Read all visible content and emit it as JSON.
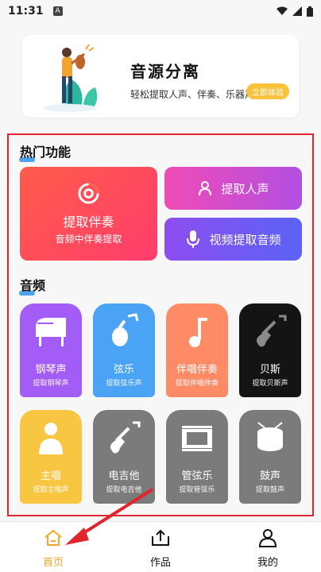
{
  "status_bar": {
    "time": "11:31",
    "a_icon_label": "A"
  },
  "banner": {
    "title": "音源分离",
    "subtitle": "轻松提取人声、伴奏、乐器声",
    "button": "立即体验"
  },
  "hot": {
    "title": "热门功能",
    "big_card": {
      "line1": "提取伴奏",
      "line2": "音频中伴奏提取"
    },
    "card_vocals": "提取人声",
    "card_video": "视频提取音频"
  },
  "audio": {
    "title": "音频",
    "tiles": [
      {
        "name": "钢琴声",
        "desc": "提取钢琴声",
        "color": "#a45cf7",
        "icon": "piano-icon"
      },
      {
        "name": "弦乐",
        "desc": "提取弦乐声",
        "color": "#4aa3f4",
        "icon": "violin-icon"
      },
      {
        "name": "伴唱伴奏",
        "desc": "提取伴唱伴奏",
        "color": "#ff8a66",
        "icon": "music-note-icon"
      },
      {
        "name": "贝斯",
        "desc": "提取贝斯声",
        "color": "#141414",
        "icon": "bass-guitar-icon"
      },
      {
        "name": "主唱",
        "desc": "提取主唱声",
        "color": "#f8c640",
        "icon": "singer-icon"
      },
      {
        "name": "电吉他",
        "desc": "提取电吉他",
        "color": "#7b7b7b",
        "icon": "electric-guitar-icon"
      },
      {
        "name": "管弦乐",
        "desc": "提取管弦乐",
        "color": "#7b7b7b",
        "icon": "film-strip-icon"
      },
      {
        "name": "鼓声",
        "desc": "提取鼓声",
        "color": "#7b7b7b",
        "icon": "drum-icon"
      }
    ]
  },
  "nav": {
    "home": "首页",
    "works": "作品",
    "mine": "我的",
    "active_color": "#f5a623"
  }
}
